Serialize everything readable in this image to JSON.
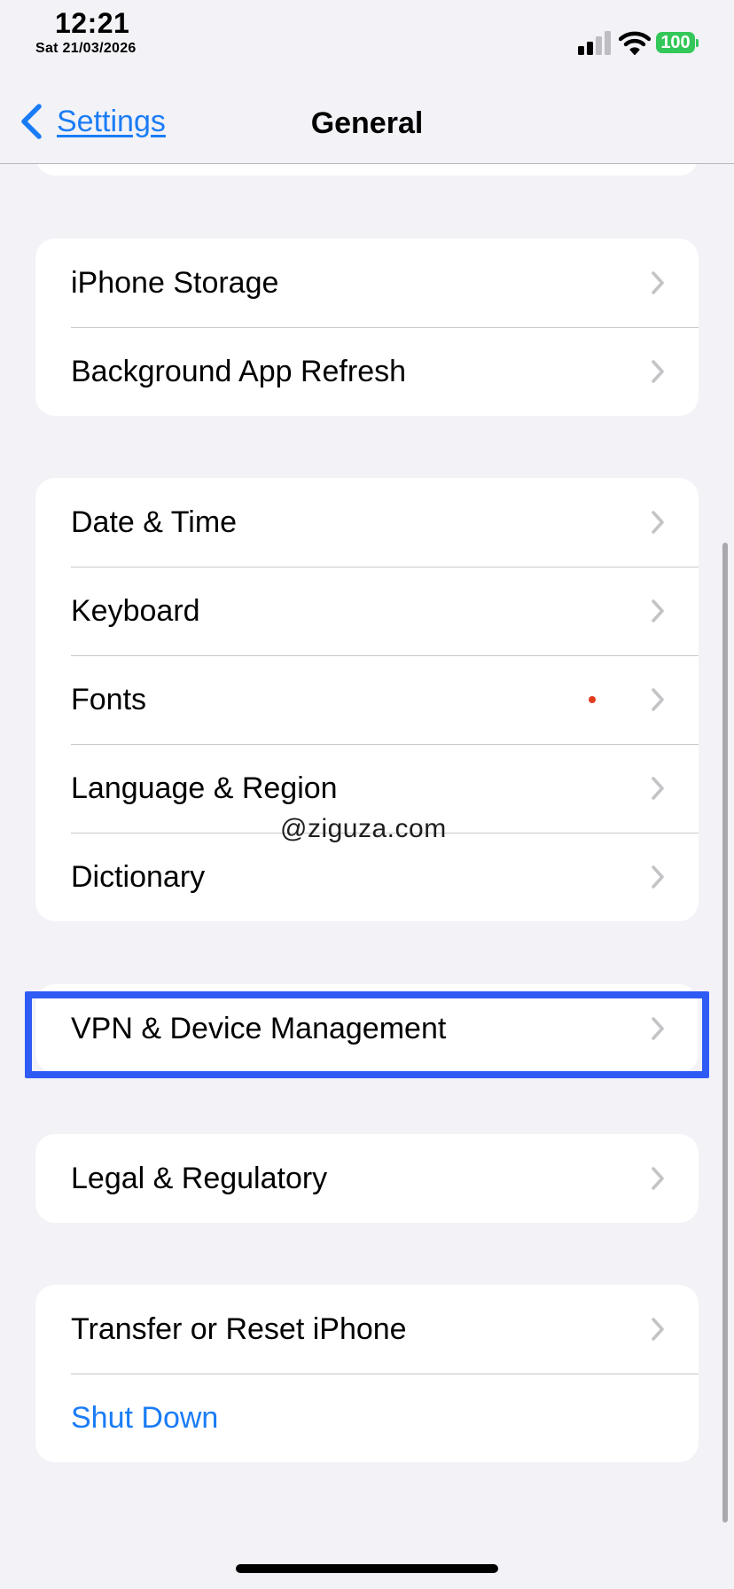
{
  "status_bar": {
    "time": "12:21",
    "date": "Sat 21/03/2026",
    "battery_level": "100",
    "signal_bars": 2,
    "signal_icon": "cellular-signal-icon",
    "wifi_icon": "wifi-icon",
    "battery_color": "#34c759"
  },
  "nav": {
    "back_label": "Settings",
    "back_icon": "chevron-left-icon",
    "title": "General",
    "accent": "#1a7cf5"
  },
  "groups": {
    "storage": [
      {
        "label": "iPhone Storage"
      },
      {
        "label": "Background App Refresh"
      }
    ],
    "locale": [
      {
        "label": "Date & Time"
      },
      {
        "label": "Keyboard"
      },
      {
        "label": "Fonts"
      },
      {
        "label": "Language & Region"
      },
      {
        "label": "Dictionary"
      }
    ],
    "vpn": [
      {
        "label": "VPN & Device Management",
        "highlighted": true
      }
    ],
    "legal": [
      {
        "label": "Legal & Regulatory"
      }
    ],
    "reset": [
      {
        "label": "Transfer or Reset iPhone"
      },
      {
        "label": "Shut Down",
        "color": "#1a7cf5"
      }
    ]
  },
  "highlight_color": "#2f5bf5",
  "watermark": "@ziguza.com"
}
